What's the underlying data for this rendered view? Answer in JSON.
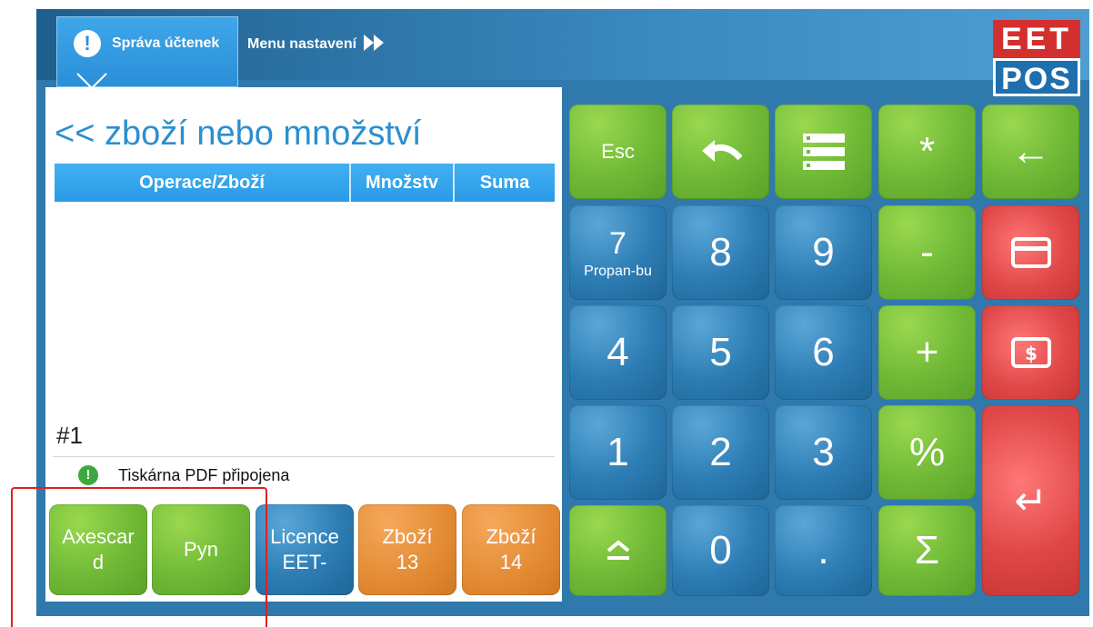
{
  "header": {
    "active_tab": "Správa účtenek",
    "menu_link": "Menu nastavení",
    "logo_top": "EET",
    "logo_bottom": "POS"
  },
  "order": {
    "title": "<< zboží nebo množství",
    "columns": [
      "Operace/Zboží",
      "Množstv",
      "Suma"
    ],
    "receipt_number": "#1",
    "status": "Tiskárna PDF připojena"
  },
  "function_keys": [
    {
      "line1": "Axescar",
      "line2": "d",
      "color": "green"
    },
    {
      "line1": "Pyn",
      "line2": "",
      "color": "green"
    },
    {
      "line1": "Licence",
      "line2": "EET-",
      "color": "blue"
    },
    {
      "line1": "Zboží",
      "line2": "13",
      "color": "orange"
    },
    {
      "line1": "Zboží",
      "line2": "14",
      "color": "orange"
    }
  ],
  "keypad": {
    "esc": "Esc",
    "star": "*",
    "back_arrow": "←",
    "seven": "7",
    "seven_sub": "Propan-bu",
    "eight": "8",
    "nine": "9",
    "minus": "-",
    "four": "4",
    "five": "5",
    "six": "6",
    "plus": "+",
    "one": "1",
    "two": "2",
    "three": "3",
    "percent": "%",
    "zero": "0",
    "dot": ".",
    "sigma": "Σ",
    "enter": "↵",
    "shift": "⏏"
  },
  "colors": {
    "accent_blue": "#2b8fd0",
    "green_key": "#6fb936",
    "blue_key": "#2c7cb3",
    "red_key": "#e04848",
    "orange_key": "#e38a33",
    "annotation_red": "#e02020"
  }
}
